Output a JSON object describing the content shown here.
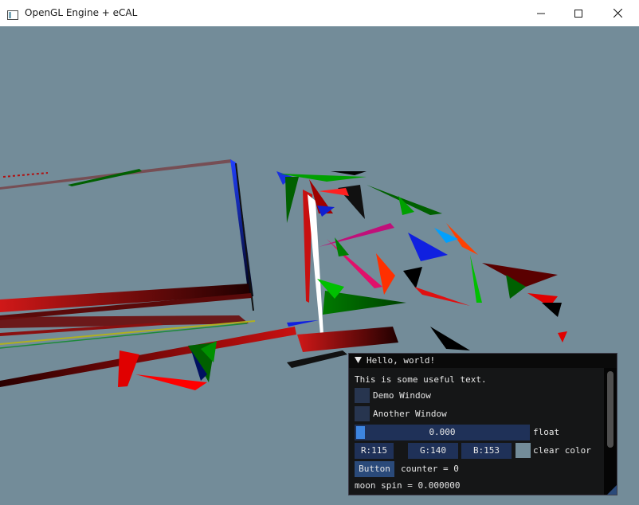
{
  "window": {
    "title": "OpenGL Engine + eCAL",
    "background_color": "#738c99",
    "icons": {
      "app": "app-window-icon",
      "minimize": "minimize-icon",
      "maximize": "maximize-icon",
      "close": "close-icon"
    }
  },
  "imgui": {
    "title": "Hello, world!",
    "text": "This is some useful text.",
    "checkboxes": [
      {
        "label": "Demo Window",
        "checked": false
      },
      {
        "label": "Another Window",
        "checked": false
      }
    ],
    "slider": {
      "value_text": "0.000",
      "label": "float",
      "fraction": 0.0
    },
    "color": {
      "r": "R:115",
      "g": "G:140",
      "b": "B:153",
      "label": "clear color",
      "swatch": "#738c99"
    },
    "button_label": "Button",
    "counter_text": "counter = 0",
    "moon_spin_text": "moon spin = 0.000000"
  }
}
